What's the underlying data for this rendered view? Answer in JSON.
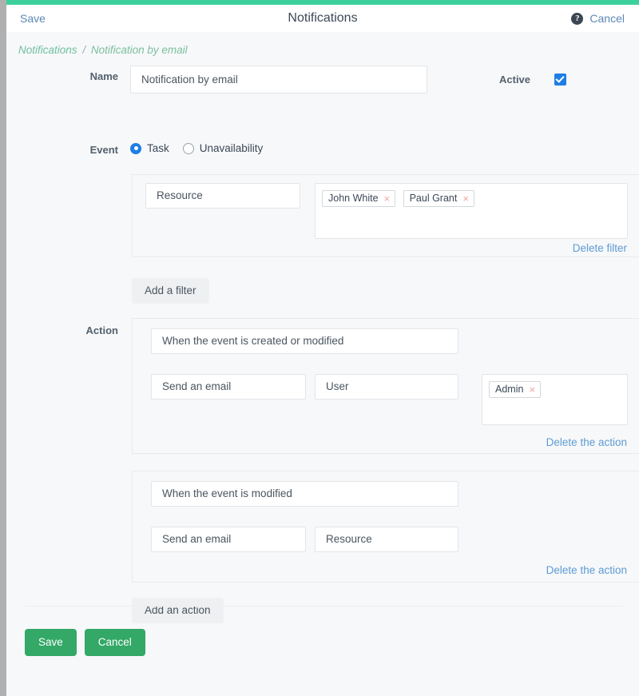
{
  "header": {
    "save_label": "Save",
    "title": "Notifications",
    "help_icon": "help-circle-icon",
    "help_glyph": "?",
    "cancel_label": "Cancel"
  },
  "breadcrumb": {
    "parent": "Notifications",
    "separator": "/",
    "current": "Notification by email"
  },
  "form": {
    "name_label": "Name",
    "name_value": "Notification by email",
    "active_label": "Active",
    "active_checked": true,
    "event_label": "Event",
    "event_options": [
      {
        "label": "Task",
        "selected": true
      },
      {
        "label": "Unavailability",
        "selected": false
      }
    ],
    "action_label": "Action"
  },
  "filters": [
    {
      "field": "Resource",
      "values": [
        {
          "label": "John White",
          "remove_glyph": "×"
        },
        {
          "label": "Paul Grant",
          "remove_glyph": "×"
        }
      ],
      "delete_label": "Delete filter"
    }
  ],
  "buttons": {
    "add_filter": "Add a filter",
    "add_action": "Add an action",
    "save": "Save",
    "cancel": "Cancel"
  },
  "actions": [
    {
      "trigger": "When the event is created or modified",
      "type": "Send an email",
      "target": "User",
      "recipients": [
        {
          "label": "Admin",
          "remove_glyph": "×"
        }
      ],
      "delete_label": "Delete the action"
    },
    {
      "trigger": "When the event is modified",
      "type": "Send an email",
      "target": "Resource",
      "recipients": [],
      "delete_label": "Delete the action"
    }
  ],
  "colors": {
    "accent_green": "#3ed09c",
    "button_green": "#33a867",
    "link_blue": "#5d9bd6",
    "breadcrumb_green": "#7cbfa0",
    "checkbox_blue": "#1e7ee5",
    "tag_remove_red": "#f2a3a3",
    "panel_bg": "#f7f8f9"
  }
}
